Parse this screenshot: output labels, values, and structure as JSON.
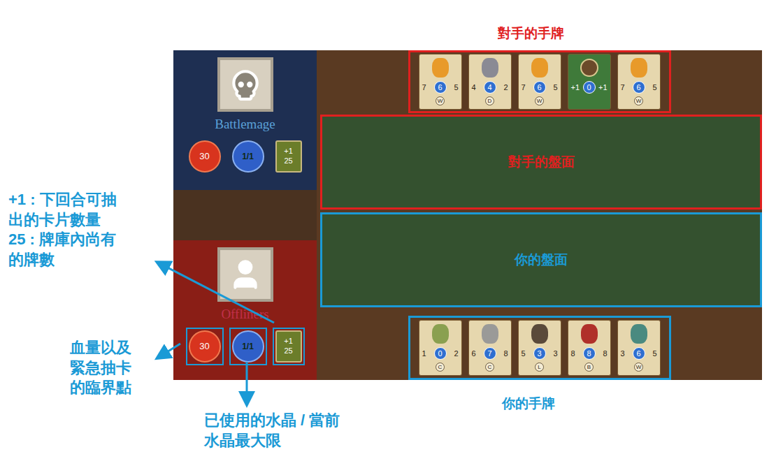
{
  "annotations": {
    "opponent_hand_title": "對手的手牌",
    "opponent_board_label": "對手的盤面",
    "your_board_label": "你的盤面",
    "your_hand_title": "你的手牌",
    "draw_deck_note": [
      "+1 : 下回合可抽",
      "出的卡片數量",
      "25 : 牌庫內尚有",
      "的牌數"
    ],
    "health_note": [
      "血量以及",
      "緊急抽卡",
      "的臨界點"
    ],
    "crystal_note": [
      "已使用的水晶 / 當前",
      "水晶最大限"
    ]
  },
  "players": [
    {
      "name": "Battlemage",
      "avatar": "skull",
      "health": "30",
      "crystals": "1/1",
      "draw": "+1",
      "deck": "25",
      "annotated": false
    },
    {
      "name": "Offliners",
      "avatar": "user",
      "health": "30",
      "crystals": "1/1",
      "draw": "+1",
      "deck": "25",
      "annotated": true
    }
  ],
  "opponent_hand": [
    {
      "kind": "creature",
      "attack": "7",
      "cost": "6",
      "health": "5",
      "tag": "W",
      "color": "#e89a2a"
    },
    {
      "kind": "creature",
      "attack": "4",
      "cost": "4",
      "health": "2",
      "tag": "D",
      "color": "#8a8a94"
    },
    {
      "kind": "creature",
      "attack": "7",
      "cost": "6",
      "health": "5",
      "tag": "W",
      "color": "#e89a2a"
    },
    {
      "kind": "spell",
      "attack": "+1",
      "cost": "0",
      "health": "+1",
      "tag": "",
      "color": "#6b4a2a"
    },
    {
      "kind": "creature",
      "attack": "7",
      "cost": "6",
      "health": "5",
      "tag": "W",
      "color": "#e89a2a"
    }
  ],
  "your_hand": [
    {
      "kind": "creature",
      "attack": "1",
      "cost": "0",
      "health": "2",
      "tag": "C",
      "color": "#8aa050"
    },
    {
      "kind": "creature",
      "attack": "6",
      "cost": "7",
      "health": "8",
      "tag": "C",
      "color": "#9a9a98"
    },
    {
      "kind": "creature",
      "attack": "5",
      "cost": "3",
      "health": "3",
      "tag": "L",
      "color": "#5a4a3a"
    },
    {
      "kind": "creature",
      "attack": "8",
      "cost": "8",
      "health": "8",
      "tag": "B",
      "color": "#b0302a"
    },
    {
      "kind": "creature",
      "attack": "3",
      "cost": "6",
      "health": "5",
      "tag": "W",
      "color": "#4a8a80"
    }
  ]
}
